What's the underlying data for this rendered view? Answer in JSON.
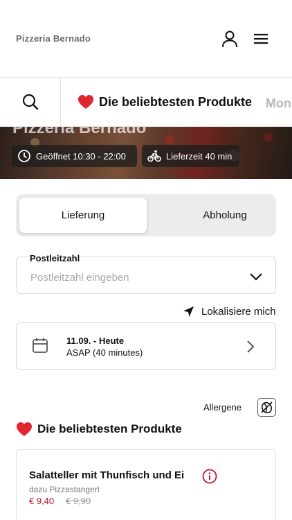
{
  "header": {
    "brand": "Pizzeria Bernado",
    "icons": {
      "account": "user-icon",
      "menu": "hamburger-menu-icon"
    }
  },
  "categories": {
    "search_icon": "search-icon",
    "active": {
      "emoji": "heart-icon",
      "label": "Die beliebtesten Produkte"
    },
    "next": {
      "label": "Mon"
    }
  },
  "hero": {
    "title": "Pizzeria Bernado",
    "opening": "Geöffnet 10:30 - 22:00",
    "delivery_time": "Lieferzeit 40 min"
  },
  "order_mode": {
    "options": [
      "Lieferung",
      "Abholung"
    ],
    "selected": "Lieferung"
  },
  "postal": {
    "label": "Postleitzahl",
    "placeholder": "Postleitzahl eingeben",
    "value": ""
  },
  "locate": {
    "label": "Lokalisiere mich"
  },
  "schedule": {
    "date": "11.09. - Heute",
    "time": "ASAP (40 minutes)"
  },
  "allergens": {
    "label": "Allergene"
  },
  "section": {
    "title": "Die beliebtesten Produkte"
  },
  "products": [
    {
      "name": "Salatteller mit Thunfisch und Ei",
      "description": "dazu Pizzastangerl",
      "price": "€ 9,40",
      "old_price": "€ 9,90"
    }
  ],
  "colors": {
    "accent_red": "#c8102e",
    "heart_red": "#e0262f",
    "border": "#d9d9d9",
    "toggle_bg": "#ececec"
  }
}
